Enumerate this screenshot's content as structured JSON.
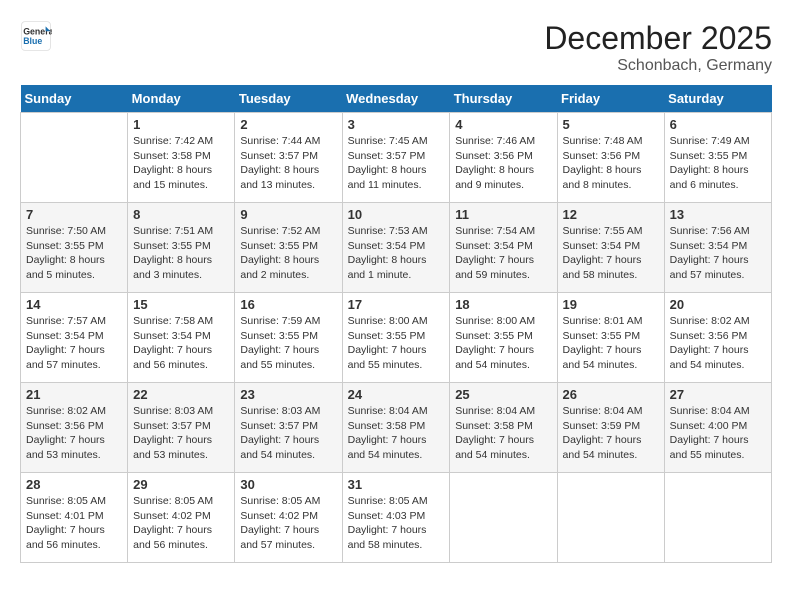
{
  "header": {
    "logo_line1": "General",
    "logo_line2": "Blue",
    "month": "December 2025",
    "location": "Schonbach, Germany"
  },
  "days_of_week": [
    "Sunday",
    "Monday",
    "Tuesday",
    "Wednesday",
    "Thursday",
    "Friday",
    "Saturday"
  ],
  "weeks": [
    [
      {
        "day": "",
        "content": ""
      },
      {
        "day": "1",
        "content": "Sunrise: 7:42 AM\nSunset: 3:58 PM\nDaylight: 8 hours\nand 15 minutes."
      },
      {
        "day": "2",
        "content": "Sunrise: 7:44 AM\nSunset: 3:57 PM\nDaylight: 8 hours\nand 13 minutes."
      },
      {
        "day": "3",
        "content": "Sunrise: 7:45 AM\nSunset: 3:57 PM\nDaylight: 8 hours\nand 11 minutes."
      },
      {
        "day": "4",
        "content": "Sunrise: 7:46 AM\nSunset: 3:56 PM\nDaylight: 8 hours\nand 9 minutes."
      },
      {
        "day": "5",
        "content": "Sunrise: 7:48 AM\nSunset: 3:56 PM\nDaylight: 8 hours\nand 8 minutes."
      },
      {
        "day": "6",
        "content": "Sunrise: 7:49 AM\nSunset: 3:55 PM\nDaylight: 8 hours\nand 6 minutes."
      }
    ],
    [
      {
        "day": "7",
        "content": "Sunrise: 7:50 AM\nSunset: 3:55 PM\nDaylight: 8 hours\nand 5 minutes."
      },
      {
        "day": "8",
        "content": "Sunrise: 7:51 AM\nSunset: 3:55 PM\nDaylight: 8 hours\nand 3 minutes."
      },
      {
        "day": "9",
        "content": "Sunrise: 7:52 AM\nSunset: 3:55 PM\nDaylight: 8 hours\nand 2 minutes."
      },
      {
        "day": "10",
        "content": "Sunrise: 7:53 AM\nSunset: 3:54 PM\nDaylight: 8 hours\nand 1 minute."
      },
      {
        "day": "11",
        "content": "Sunrise: 7:54 AM\nSunset: 3:54 PM\nDaylight: 7 hours\nand 59 minutes."
      },
      {
        "day": "12",
        "content": "Sunrise: 7:55 AM\nSunset: 3:54 PM\nDaylight: 7 hours\nand 58 minutes."
      },
      {
        "day": "13",
        "content": "Sunrise: 7:56 AM\nSunset: 3:54 PM\nDaylight: 7 hours\nand 57 minutes."
      }
    ],
    [
      {
        "day": "14",
        "content": "Sunrise: 7:57 AM\nSunset: 3:54 PM\nDaylight: 7 hours\nand 57 minutes."
      },
      {
        "day": "15",
        "content": "Sunrise: 7:58 AM\nSunset: 3:54 PM\nDaylight: 7 hours\nand 56 minutes."
      },
      {
        "day": "16",
        "content": "Sunrise: 7:59 AM\nSunset: 3:55 PM\nDaylight: 7 hours\nand 55 minutes."
      },
      {
        "day": "17",
        "content": "Sunrise: 8:00 AM\nSunset: 3:55 PM\nDaylight: 7 hours\nand 55 minutes."
      },
      {
        "day": "18",
        "content": "Sunrise: 8:00 AM\nSunset: 3:55 PM\nDaylight: 7 hours\nand 54 minutes."
      },
      {
        "day": "19",
        "content": "Sunrise: 8:01 AM\nSunset: 3:55 PM\nDaylight: 7 hours\nand 54 minutes."
      },
      {
        "day": "20",
        "content": "Sunrise: 8:02 AM\nSunset: 3:56 PM\nDaylight: 7 hours\nand 54 minutes."
      }
    ],
    [
      {
        "day": "21",
        "content": "Sunrise: 8:02 AM\nSunset: 3:56 PM\nDaylight: 7 hours\nand 53 minutes."
      },
      {
        "day": "22",
        "content": "Sunrise: 8:03 AM\nSunset: 3:57 PM\nDaylight: 7 hours\nand 53 minutes."
      },
      {
        "day": "23",
        "content": "Sunrise: 8:03 AM\nSunset: 3:57 PM\nDaylight: 7 hours\nand 54 minutes."
      },
      {
        "day": "24",
        "content": "Sunrise: 8:04 AM\nSunset: 3:58 PM\nDaylight: 7 hours\nand 54 minutes."
      },
      {
        "day": "25",
        "content": "Sunrise: 8:04 AM\nSunset: 3:58 PM\nDaylight: 7 hours\nand 54 minutes."
      },
      {
        "day": "26",
        "content": "Sunrise: 8:04 AM\nSunset: 3:59 PM\nDaylight: 7 hours\nand 54 minutes."
      },
      {
        "day": "27",
        "content": "Sunrise: 8:04 AM\nSunset: 4:00 PM\nDaylight: 7 hours\nand 55 minutes."
      }
    ],
    [
      {
        "day": "28",
        "content": "Sunrise: 8:05 AM\nSunset: 4:01 PM\nDaylight: 7 hours\nand 56 minutes."
      },
      {
        "day": "29",
        "content": "Sunrise: 8:05 AM\nSunset: 4:02 PM\nDaylight: 7 hours\nand 56 minutes."
      },
      {
        "day": "30",
        "content": "Sunrise: 8:05 AM\nSunset: 4:02 PM\nDaylight: 7 hours\nand 57 minutes."
      },
      {
        "day": "31",
        "content": "Sunrise: 8:05 AM\nSunset: 4:03 PM\nDaylight: 7 hours\nand 58 minutes."
      },
      {
        "day": "",
        "content": ""
      },
      {
        "day": "",
        "content": ""
      },
      {
        "day": "",
        "content": ""
      }
    ]
  ]
}
